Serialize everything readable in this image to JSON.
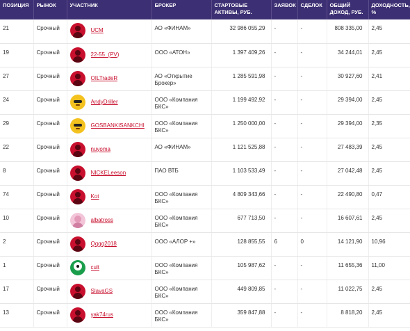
{
  "table": {
    "headers": {
      "position": "ПОЗИЦИЯ",
      "market": "РЫНОК",
      "participant": "УЧАСТНИК",
      "broker": "БРОКЕР",
      "start_assets": "СТАРТОВЫЕ АКТИВЫ, РУБ.",
      "orders": "ЗАЯВОК",
      "deals": "СДЕЛОК",
      "total_income": "ОБЩИЙ ДОХОД, РУБ.",
      "yield": "ДОХОДНОСТЬ, %"
    },
    "rows": [
      {
        "position": "21",
        "market": "Срочный",
        "avatar": "red-user-icon",
        "name": "UCM",
        "broker": "АО «ФИНАМ»",
        "start_assets": "32 986 055,29",
        "orders": "-",
        "deals": "-",
        "total_income": "808 335,00",
        "yield": "2,45"
      },
      {
        "position": "19",
        "market": "Срочный",
        "avatar": "red-user-icon",
        "name": "22-55_(PV)",
        "broker": "ООО «АТОН»",
        "start_assets": "1 397 409,26",
        "orders": "-",
        "deals": "-",
        "total_income": "34 244,01",
        "yield": "2,45"
      },
      {
        "position": "27",
        "market": "Срочный",
        "avatar": "red-user-icon",
        "name": "OILTradeR",
        "broker": "АО «Открытие Брокер»",
        "start_assets": "1 285 591,98",
        "orders": "-",
        "deals": "-",
        "total_income": "30 927,60",
        "yield": "2,41"
      },
      {
        "position": "24",
        "market": "Срочный",
        "avatar": "sunglasses-avatar-icon",
        "name": "AndyDriller",
        "broker": "ООО «Компания БКС»",
        "start_assets": "1 199 492,92",
        "orders": "-",
        "deals": "-",
        "total_income": "29 394,00",
        "yield": "2,45"
      },
      {
        "position": "29",
        "market": "Срочный",
        "avatar": "emoji-avatar-icon",
        "name": "GOSBANKISANKCHI",
        "broker": "ООО «Компания БКС»",
        "start_assets": "1 250 000,00",
        "orders": "-",
        "deals": "-",
        "total_income": "29 394,00",
        "yield": "2,35"
      },
      {
        "position": "22",
        "market": "Срочный",
        "avatar": "red-user-icon",
        "name": "nuyoma",
        "broker": "АО «ФИНАМ»",
        "start_assets": "1 121 525,88",
        "orders": "-",
        "deals": "-",
        "total_income": "27 483,39",
        "yield": "2,45"
      },
      {
        "position": "8",
        "market": "Срочный",
        "avatar": "red-user-icon",
        "name": "NICKELeeson",
        "broker": "ПАО ВТБ",
        "start_assets": "1 103 533,49",
        "orders": "-",
        "deals": "-",
        "total_income": "27 042,48",
        "yield": "2,45"
      },
      {
        "position": "74",
        "market": "Срочный",
        "avatar": "red-user-icon",
        "name": "Kot",
        "broker": "ООО «Компания БКС»",
        "start_assets": "4 809 343,66",
        "orders": "-",
        "deals": "-",
        "total_income": "22 490,80",
        "yield": "0,47"
      },
      {
        "position": "10",
        "market": "Срочный",
        "avatar": "pink-photo-avatar-icon",
        "name": "albatross",
        "broker": "ООО «Компания БКС»",
        "start_assets": "677 713,50",
        "orders": "-",
        "deals": "-",
        "total_income": "16 607,61",
        "yield": "2,45"
      },
      {
        "position": "2",
        "market": "Срочный",
        "avatar": "red-user-icon",
        "name": "Qqqq2018",
        "broker": "ООО «АЛОР +»",
        "start_assets": "128 855,55",
        "orders": "6",
        "deals": "0",
        "total_income": "14 121,90",
        "yield": "10,96"
      },
      {
        "position": "1",
        "market": "Срочный",
        "avatar": "green-photo-avatar-icon",
        "name": "cult",
        "broker": "ООО «Компания БКС»",
        "start_assets": "105 987,62",
        "orders": "-",
        "deals": "-",
        "total_income": "11 655,36",
        "yield": "11,00"
      },
      {
        "position": "17",
        "market": "Срочный",
        "avatar": "red-user-icon",
        "name": "SlavaGS",
        "broker": "ООО «Компания БКС»",
        "start_assets": "449 809,85",
        "orders": "-",
        "deals": "-",
        "total_income": "11 022,75",
        "yield": "2,45"
      },
      {
        "position": "13",
        "market": "Срочный",
        "avatar": "red-user-icon",
        "name": "yak74rus",
        "broker": "ООО «Компания БКС»",
        "start_assets": "359 847,88",
        "orders": "-",
        "deals": "-",
        "total_income": "8 818,20",
        "yield": "2,45"
      }
    ]
  },
  "colors": {
    "header_bg": "#3d2f73",
    "header_text": "#ffffff",
    "link": "#c8102e",
    "text": "#333333",
    "row_border": "#e6e6e6"
  }
}
